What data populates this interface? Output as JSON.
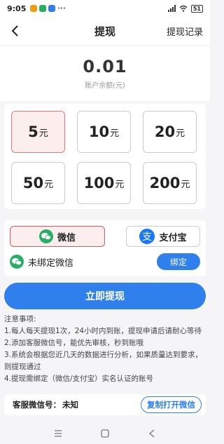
{
  "status_bar": {
    "time": "9:05",
    "battery": "51"
  },
  "header": {
    "title": "提现",
    "records_label": "提现记录"
  },
  "balance": {
    "amount": "0.01",
    "label": "账户余额(元)"
  },
  "amounts": [
    {
      "value": "5",
      "unit": "元",
      "selected": true
    },
    {
      "value": "10",
      "unit": "元",
      "selected": false
    },
    {
      "value": "20",
      "unit": "元",
      "selected": false
    },
    {
      "value": "50",
      "unit": "元",
      "selected": false
    },
    {
      "value": "100",
      "unit": "元",
      "selected": false
    },
    {
      "value": "200",
      "unit": "元",
      "selected": false
    }
  ],
  "payment": {
    "wechat_label": "微信",
    "alipay_label": "支付宝",
    "bind_status": "未绑定微信",
    "bind_button": "绑定"
  },
  "withdraw_button": "立即提现",
  "notes": {
    "heading": "注意事项:",
    "items": [
      "1.每人每天提现1次，24小时内到账，提现申请后请耐心等待",
      "2.添加客服微信号，能优先审核，秒到账哦",
      "3.系统会根据您近几天的数据进行分析，如果质量达到要求，则提现通过",
      "4.提现需绑定（微信/支付宝）实名认证的账号"
    ]
  },
  "service": {
    "label": "客服微信号：",
    "value": "未知",
    "copy_button": "复制打开微信"
  },
  "colors": {
    "accent": "#2f80ed",
    "selected_bg": "#fdeeee",
    "selected_border": "#e07a7a",
    "wechat": "#2aae67",
    "alipay": "#1677ff"
  }
}
